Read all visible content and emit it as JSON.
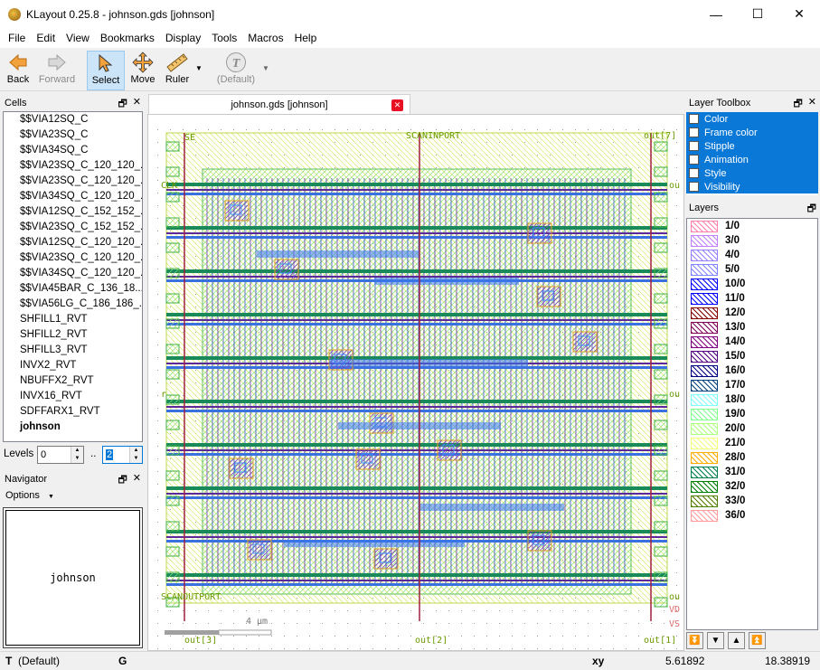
{
  "window": {
    "title": "KLayout 0.25.8 - johnson.gds [johnson]",
    "minimize": "—",
    "maximize": "☐",
    "close": "✕"
  },
  "menu": [
    "File",
    "Edit",
    "View",
    "Bookmarks",
    "Display",
    "Tools",
    "Macros",
    "Help"
  ],
  "toolbar": {
    "back": "Back",
    "forward": "Forward",
    "select": "Select",
    "move": "Move",
    "ruler": "Ruler",
    "default": "(Default)"
  },
  "cells_panel": {
    "title": "Cells",
    "items": [
      "$$VIA12SQ_C",
      "$$VIA23SQ_C",
      "$$VIA34SQ_C",
      "$$VIA23SQ_C_120_120_...",
      "$$VIA23SQ_C_120_120_...",
      "$$VIA34SQ_C_120_120_...",
      "$$VIA12SQ_C_152_152_...",
      "$$VIA23SQ_C_152_152_...",
      "$$VIA12SQ_C_120_120_...",
      "$$VIA23SQ_C_120_120_...",
      "$$VIA34SQ_C_120_120_...",
      "$$VIA45BAR_C_136_18...",
      "$$VIA56LG_C_186_186_...",
      "SHFILL1_RVT",
      "SHFILL2_RVT",
      "SHFILL3_RVT",
      "INVX2_RVT",
      "NBUFFX2_RVT",
      "INVX16_RVT",
      "SDFFARX1_RVT",
      "johnson"
    ],
    "levels_label": "Levels",
    "level_min": "0",
    "level_sep": "..",
    "level_max": "2"
  },
  "navigator": {
    "title": "Navigator",
    "options": "Options",
    "cell_name": "johnson"
  },
  "tab": {
    "label": "johnson.gds [johnson]"
  },
  "layout_labels": {
    "top_left": "SE",
    "top_center": "SCANINPORT",
    "top_right": "out[7]",
    "left_1": "CLK",
    "left_2": "r",
    "right_1": "ou",
    "right_2": "ou",
    "scan_out": "SCANOUTPORT",
    "right_3": "ou",
    "vdd": "VD",
    "vss": "VS",
    "bottom_1": "out[3]",
    "bottom_2": "out[2]",
    "bottom_3": "out[1]",
    "scale": "4 μm"
  },
  "layer_toolbox": {
    "title": "Layer Toolbox",
    "items": [
      "Color",
      "Frame color",
      "Stipple",
      "Animation",
      "Style",
      "Visibility"
    ]
  },
  "layers_panel": {
    "title": "Layers",
    "items": [
      {
        "name": "1/0",
        "color": "#ff80a8"
      },
      {
        "name": "3/0",
        "color": "#c080ff"
      },
      {
        "name": "4/0",
        "color": "#9580ff"
      },
      {
        "name": "5/0",
        "color": "#8086ff"
      },
      {
        "name": "10/0",
        "color": "#0000ff"
      },
      {
        "name": "11/0",
        "color": "#0000ff"
      },
      {
        "name": "12/0",
        "color": "#800000"
      },
      {
        "name": "13/0",
        "color": "#800057"
      },
      {
        "name": "14/0",
        "color": "#800080"
      },
      {
        "name": "15/0",
        "color": "#500080"
      },
      {
        "name": "16/0",
        "color": "#000080"
      },
      {
        "name": "17/0",
        "color": "#004080"
      },
      {
        "name": "18/0",
        "color": "#80fffb"
      },
      {
        "name": "19/0",
        "color": "#80ff8d"
      },
      {
        "name": "20/0",
        "color": "#afff80"
      },
      {
        "name": "21/0",
        "color": "#f3ff80"
      },
      {
        "name": "28/0",
        "color": "#ffae00"
      },
      {
        "name": "31/0",
        "color": "#008050"
      },
      {
        "name": "32/0",
        "color": "#008000"
      },
      {
        "name": "33/0",
        "color": "#508000"
      },
      {
        "name": "36/0",
        "color": "#ff9d9d"
      }
    ]
  },
  "statusbar": {
    "t": "T",
    "default": "(Default)",
    "g": "G",
    "xy_label": "xy",
    "x": "5.61892",
    "y": "18.38919"
  }
}
